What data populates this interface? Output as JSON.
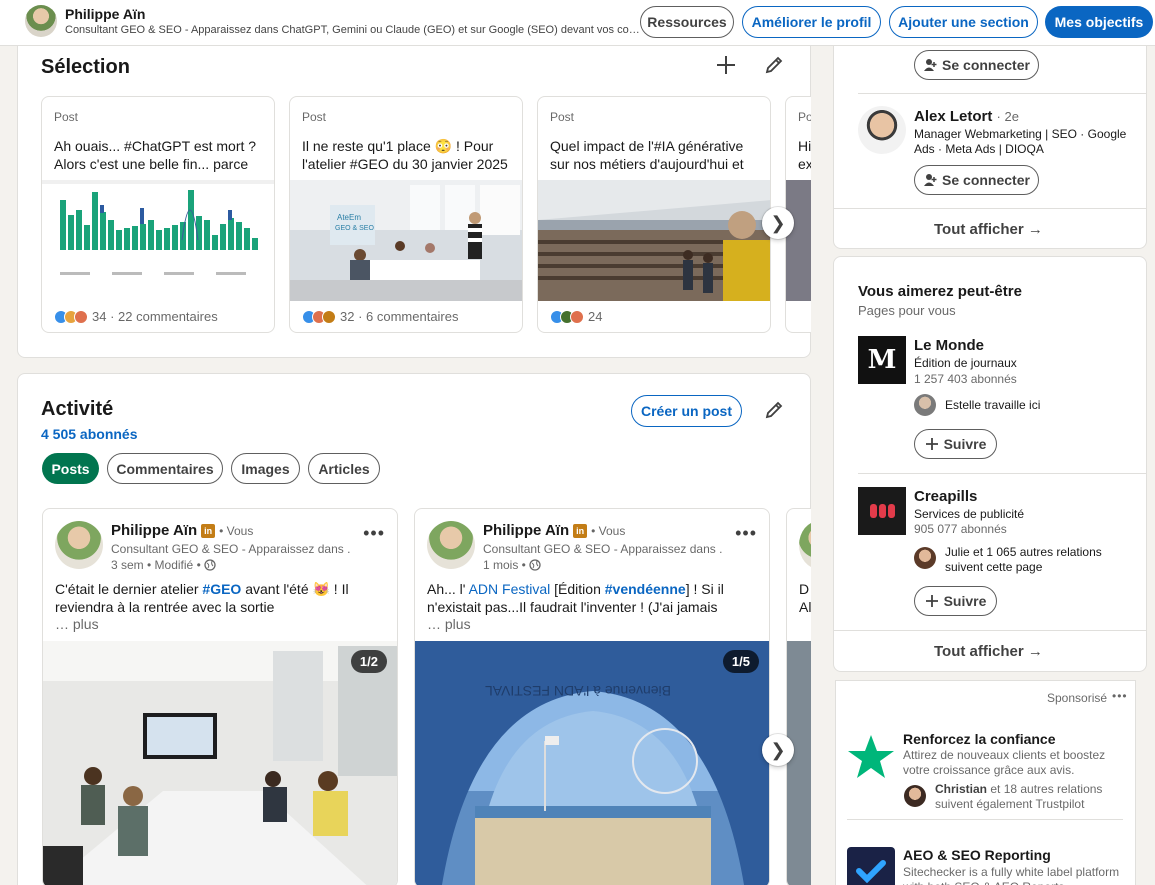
{
  "header": {
    "name": "Philippe Aïn",
    "headline": "Consultant GEO & SEO - Apparaissez dans ChatGPT, Gemini ou Claude (GEO) et sur Google (SEO) devant vos concurrents",
    "buttons": {
      "resources": "Ressources",
      "improve": "Améliorer le profil",
      "add_section": "Ajouter une section",
      "goals": "Mes objectifs"
    }
  },
  "selection": {
    "title": "Sélection",
    "items": [
      {
        "kind": "Post",
        "text": "Ah ouais... #ChatGPT est mort ? Alors c'est une belle fin... parce que",
        "reactions": "34 · 22 commentaires"
      },
      {
        "kind": "Post",
        "text": "Il ne reste qu'1 place 😳 ! Pour l'atelier #GEO du 30 janvier 2025",
        "reactions": "32 · 6 commentaires"
      },
      {
        "kind": "Post",
        "text": "Quel impact de l'#IA générative sur nos métiers d'aujourd'hui et demain ?",
        "reactions": "24"
      },
      {
        "kind": "Po",
        "text": "Hi ex",
        "reactions": ""
      }
    ],
    "next": "❯"
  },
  "activity": {
    "title": "Activité",
    "followers": "4 505 abonnés",
    "create_post": "Créer un post",
    "filters": [
      "Posts",
      "Commentaires",
      "Images",
      "Articles"
    ],
    "posts": [
      {
        "author": "Philippe Aïn",
        "in_badge": "in",
        "you": "• Vous",
        "headline": "Consultant GEO & SEO - Apparaissez dans ...",
        "time": "3 sem • Modifié •",
        "text_a": "C'était le dernier atelier ",
        "tag": "#GEO",
        "text_b": " avant l'été 😻 ! Il reviendra à la rentrée avec la sortie",
        "more": "… plus",
        "count": "1/2",
        "dots": "•••"
      },
      {
        "author": "Philippe Aïn",
        "in_badge": "in",
        "you": "• Vous",
        "headline": "Consultant GEO & SEO - Apparaissez dans ...",
        "time": "1 mois •",
        "text_a": "Ah... l' ",
        "tag": "ADN Festival",
        "text_b": " [Édition ",
        "tag2": "#vendéenne",
        "text_c": "] ! Si il n'existait pas...Il faudrait l'inventer ! (J'ai jamais",
        "more": "… plus",
        "count": "1/5",
        "dots": "•••"
      },
      {
        "partial1": "D",
        "partial2": "Al"
      }
    ],
    "next": "❯"
  },
  "people": {
    "connect_top": "Se connecter",
    "person": {
      "name": "Alex Letort",
      "degree": "· 2e",
      "headline": "Manager Webmarketing | SEO · Google Ads · Meta Ads | DIOQA",
      "connect": "Se connecter"
    },
    "show_all": "Tout afficher →"
  },
  "pages": {
    "title": "Vous aimerez peut-être",
    "subtitle": "Pages pour vous",
    "items": [
      {
        "name": "Le Monde",
        "category": "Édition de journaux",
        "followers": "1 257 403 abonnés",
        "social": "Estelle travaille ici",
        "follow": "Suivre"
      },
      {
        "name": "Creapills",
        "category": "Services de publicité",
        "followers": "905 077 abonnés",
        "social": "Julie et 1 065 autres relations suivent cette page",
        "follow": "Suivre"
      }
    ],
    "show_all": "Tout afficher →"
  },
  "sponsored": {
    "label": "Sponsorisé",
    "dots": "•••",
    "items": [
      {
        "title": "Renforcez la confiance",
        "text": "Attirez de nouveaux clients et boostez votre croissance grâce aux avis.",
        "social_name": "Christian",
        "social_rest": " et 18 autres relations suivent également Trustpilot"
      },
      {
        "title": "AEO & SEO Reporting",
        "text": "Sitechecker is a fully white label platform with both SEO & AEO Reports"
      }
    ]
  },
  "colors": {
    "accent": "#0a66c2",
    "green_chip": "#01754f",
    "bg": "#f4f2ee"
  }
}
